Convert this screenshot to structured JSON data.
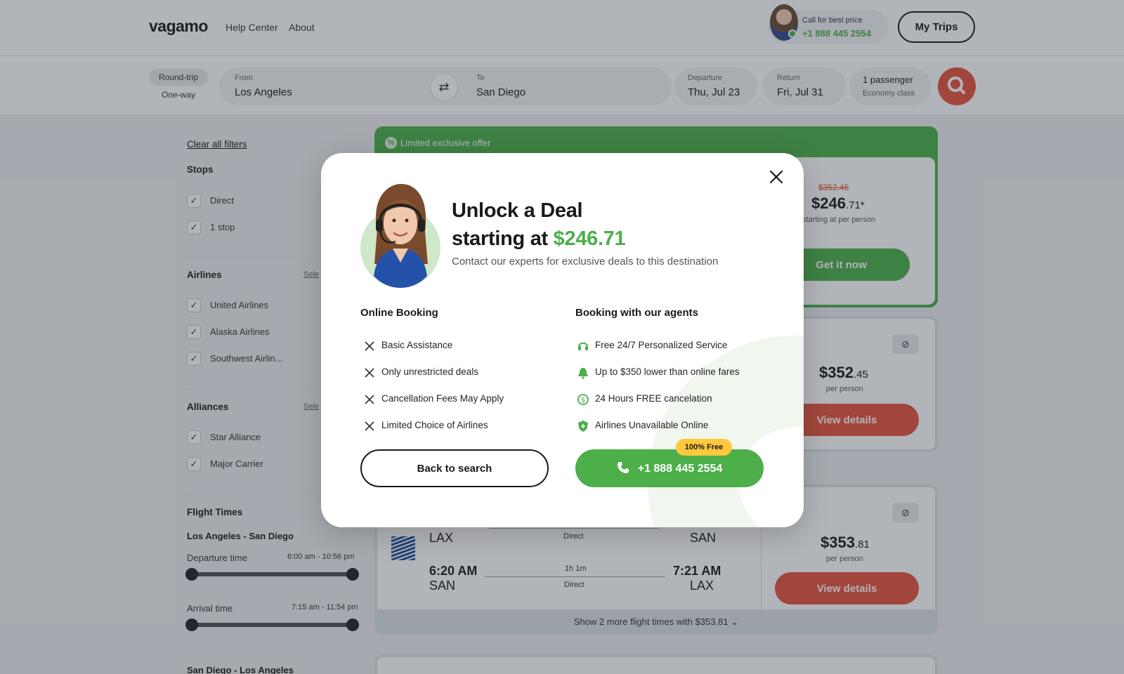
{
  "header": {
    "logo": "vagamo",
    "nav": [
      "Help Center",
      "About"
    ],
    "call_label": "Call for best price",
    "call_number": "+1 888 445 2554",
    "my_trips": "My Trips"
  },
  "search": {
    "trip_types": [
      "Round-trip",
      "One-way"
    ],
    "from_label": "From",
    "from_value": "Los Angeles",
    "to_label": "To",
    "to_value": "San Diego",
    "departure_label": "Departure",
    "departure_value": "Thu, Jul 23",
    "return_label": "Return",
    "return_value": "Fri, Jul 31",
    "passengers": "1 passenger",
    "cabin": "Economy class"
  },
  "filters": {
    "clear_all": "Clear all filters",
    "stops_title": "Stops",
    "stops": [
      "Direct",
      "1 stop"
    ],
    "airlines_title": "Airlines",
    "airlines_link": "Sele",
    "airlines": [
      "United Airlines",
      "Alaska Airlines",
      "Southwest Airlin..."
    ],
    "alliances_title": "Alliances",
    "alliances_link": "Sele",
    "alliances": [
      "Star Alliance",
      "Major Carrier"
    ],
    "flight_times_title": "Flight Times",
    "route_out": "Los Angeles - San Diego",
    "departure_time_label": "Departure time",
    "departure_time_range": "6:00 am - 10:56 pm",
    "arrival_time_label": "Arrival time",
    "arrival_time_range": "7:15 am - 11:54 pm",
    "route_return": "San Diego - Los Angeles"
  },
  "results": {
    "offer_banner": "Limited exclusive offer",
    "offer_old_price": "$352.45",
    "offer_price_main": "$246",
    "offer_price_cents": ".71*",
    "offer_per": "starting at per person",
    "offer_button": "Get it now",
    "card2_price_main": "$352",
    "card2_price_cents": ".45",
    "card2_per": "per person",
    "card2_button": "View details",
    "card3_price_main": "$353",
    "card3_price_cents": ".81",
    "card3_per": "per person",
    "card3_button": "View details",
    "card3_out_from": "LAX",
    "card3_out_to": "SAN",
    "card3_out_stops": "Direct",
    "card3_ret_depart": "6:20 AM",
    "card3_ret_from": "SAN",
    "card3_ret_arrive": "7:21 AM",
    "card3_ret_to": "LAX",
    "card3_ret_duration": "1h 1m",
    "card3_ret_stops": "Direct",
    "more_times": "Show 2 more flight times with $353.81"
  },
  "modal": {
    "title_line1": "Unlock a Deal",
    "title_line2_prefix": "starting at ",
    "title_price": "$246.71",
    "subtitle": "Contact our experts for exclusive deals to this destination",
    "online_title": "Online Booking",
    "online_items": [
      "Basic Assistance",
      "Only unrestricted deals",
      "Cancellation Fees May Apply",
      "Limited Choice of Airlines"
    ],
    "agents_title": "Booking with our agents",
    "agents_items": [
      "Free 24/7 Personalized Service",
      "Up to $350 lower than online fares",
      "24 Hours FREE cancelation",
      "Airlines Unavailable Online"
    ],
    "back_button": "Back to search",
    "phone_button": "+1 888 445 2554",
    "free_badge": "100% Free"
  },
  "colors": {
    "brand_green": "#4caf4a",
    "brand_red": "#e8543f",
    "badge_yellow": "#ffc83d"
  }
}
